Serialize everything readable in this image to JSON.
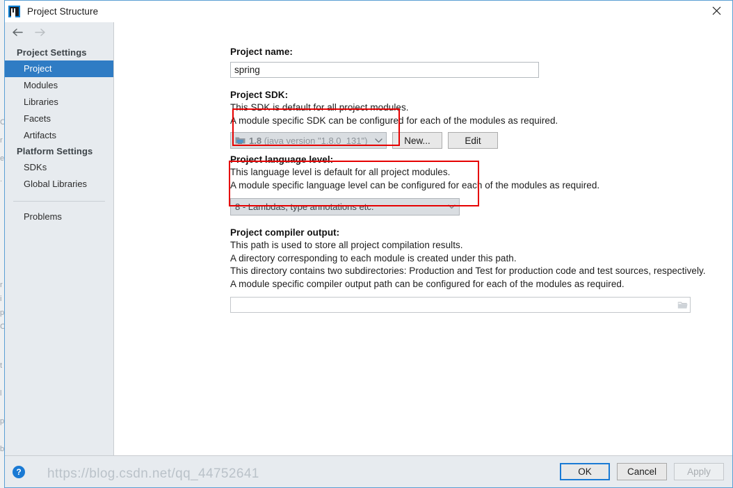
{
  "window": {
    "title": "Project Structure",
    "logo_icon": "intellij-idea-logo-icon",
    "close_icon": "close-icon"
  },
  "nav": {
    "back_icon": "arrow-left-icon",
    "forward_icon": "arrow-right-icon"
  },
  "sidebar": {
    "groups": [
      {
        "header": "Project Settings",
        "items": [
          {
            "label": "Project",
            "selected": true
          },
          {
            "label": "Modules",
            "selected": false
          },
          {
            "label": "Libraries",
            "selected": false
          },
          {
            "label": "Facets",
            "selected": false
          },
          {
            "label": "Artifacts",
            "selected": false
          }
        ]
      },
      {
        "header": "Platform Settings",
        "items": [
          {
            "label": "SDKs",
            "selected": false
          },
          {
            "label": "Global Libraries",
            "selected": false
          }
        ]
      }
    ],
    "problems_label": "Problems"
  },
  "main": {
    "project_name": {
      "label": "Project name:",
      "value": "spring",
      "placeholder": ""
    },
    "project_sdk": {
      "label": "Project SDK:",
      "desc_line_1": "This SDK is default for all project modules.",
      "desc_line_2": "A module specific SDK can be configured for each of the modules as required.",
      "combo_icon": "sdk-folder-icon",
      "combo_version": "1.8",
      "combo_detail": "(java version \"1.8.0_131\")",
      "chevron_icon": "chevron-down-icon",
      "new_button": "New...",
      "edit_button": "Edit"
    },
    "language_level": {
      "label": "Project language level:",
      "desc_line_1": "This language level is default for all project modules.",
      "desc_line_2": "A module specific language level can be configured for each of the modules as required.",
      "selected": "8 - Lambdas, type annotations etc.",
      "chevron_icon": "chevron-down-icon"
    },
    "compiler_output": {
      "label": "Project compiler output:",
      "desc_line_1": "This path is used to store all project compilation results.",
      "desc_line_2": "A directory corresponding to each module is created under this path.",
      "desc_line_3": "This directory contains two subdirectories: Production and Test for production code and test sources, respectively.",
      "desc_line_4": "A module specific compiler output path can be configured for each of the modules as required.",
      "value": "",
      "placeholder": "",
      "browse_icon": "folder-browse-icon"
    }
  },
  "footer": {
    "help_icon": "help-question-icon",
    "help_label": "?",
    "ok_label": "OK",
    "cancel_label": "Cancel",
    "apply_label": "Apply"
  },
  "watermark": {
    "text": "https://blog.csdn.net/qq_44752641"
  },
  "colors": {
    "accent": "#2f7cc4",
    "annotation": "#e60000",
    "sidebar_bg": "#e7ebef",
    "window_border": "#5a9fd4"
  },
  "bg_bleed_glyphs": [
    "C",
    "r",
    "e",
    ".",
    "r",
    "i",
    "p",
    "C",
    "t",
    "l",
    "p",
    "b"
  ]
}
